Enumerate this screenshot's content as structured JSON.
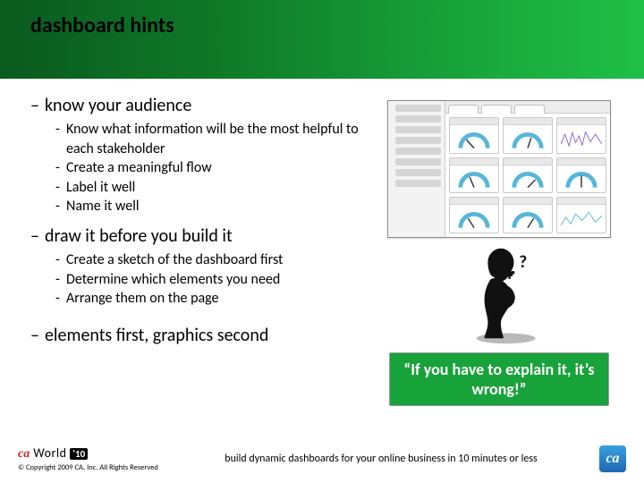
{
  "slide": {
    "title": "dashboard hints",
    "sections": [
      {
        "heading": "know your audience",
        "bullets": [
          "Know what information will be the most helpful to each stakeholder",
          "Create a meaningful flow",
          "Label it well",
          "Name it well"
        ]
      },
      {
        "heading": "draw it before you build it",
        "bullets": [
          "Create a sketch of the dashboard first",
          "Determine which elements you need",
          "Arrange them on the page"
        ]
      },
      {
        "heading": "elements first, graphics second",
        "bullets": []
      }
    ],
    "callout": "“If you have to explain it, it’s wrong!”",
    "footer": {
      "brand_ca": "ca",
      "brand_world": "World",
      "brand_year": "'10",
      "copyright": "© Copyright 2009 CA, Inc. All Rights Reserved",
      "tagline": "build dynamic dashboards for your online business in 10 minutes or less",
      "logo_text": "ca"
    }
  }
}
